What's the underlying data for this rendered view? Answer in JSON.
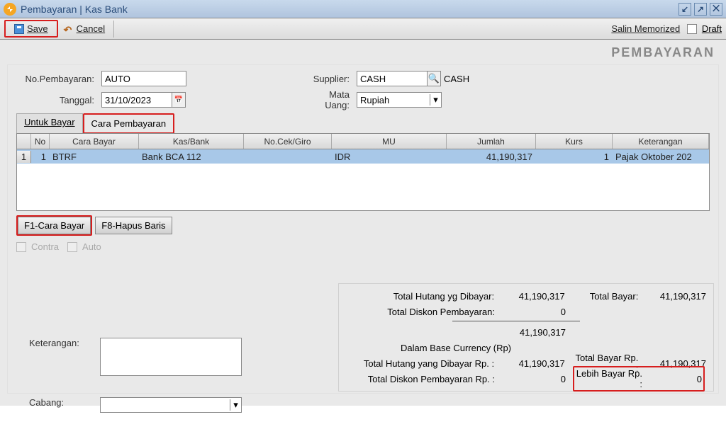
{
  "titlebar": {
    "title": "Pembayaran | Kas Bank"
  },
  "toolbar": {
    "save_label": "Save",
    "cancel_label": "Cancel",
    "salin_label": "Salin Memorized",
    "draft_label": "Draft"
  },
  "heading": "PEMBAYARAN",
  "form": {
    "no_pembayaran_label": "No.Pembayaran:",
    "no_pembayaran_value": "AUTO",
    "tanggal_label": "Tanggal:",
    "tanggal_value": "31/10/2023",
    "supplier_label": "Supplier:",
    "supplier_value": "CASH",
    "supplier_name": "CASH",
    "mata_uang_label": "Mata Uang:",
    "mata_uang_value": "Rupiah"
  },
  "tabs": {
    "untuk_bayar": "Untuk Bayar",
    "cara_pembayaran": "Cara Pembayaran"
  },
  "grid": {
    "headers": {
      "no": "No",
      "cara_bayar": "Cara Bayar",
      "kas_bank": "Kas/Bank",
      "no_cek": "No.Cek/Giro",
      "mu": "MU",
      "jumlah": "Jumlah",
      "kurs": "Kurs",
      "keterangan": "Keterangan"
    },
    "rows": [
      {
        "rownum": "1",
        "no": "1",
        "cara_bayar": "BTRF",
        "kas_bank": "Bank BCA 112",
        "no_cek": "",
        "mu": "IDR",
        "jumlah": "41,190,317",
        "kurs": "1",
        "keterangan": "Pajak Oktober 202"
      }
    ],
    "buttons": {
      "f1": "F1-Cara Bayar",
      "f8": "F8-Hapus Baris"
    }
  },
  "checkboxes": {
    "contra": "Contra",
    "auto": "Auto"
  },
  "lower": {
    "keterangan_label": "Keterangan:",
    "keterangan_value": "",
    "cabang_label": "Cabang:",
    "cabang_value": ""
  },
  "totals": {
    "total_hutang_lbl": "Total Hutang yg Dibayar:",
    "total_hutang_val": "41,190,317",
    "total_bayar_lbl": "Total Bayar:",
    "total_bayar_val": "41,190,317",
    "total_diskon_lbl": "Total Diskon Pembayaran:",
    "total_diskon_val": "0",
    "subtotal_val": "41,190,317",
    "base_curr_lbl": "Dalam Base Currency (Rp)",
    "total_hutang_rp_lbl": "Total Hutang yang Dibayar Rp. :",
    "total_hutang_rp_val": "41,190,317",
    "total_bayar_rp_lbl": "Total Bayar Rp. :",
    "total_bayar_rp_val": "41,190,317",
    "total_diskon_rp_lbl": "Total Diskon Pembayaran Rp. :",
    "total_diskon_rp_val": "0",
    "lebih_bayar_lbl": "Lebih Bayar Rp. :",
    "lebih_bayar_val": "0"
  }
}
